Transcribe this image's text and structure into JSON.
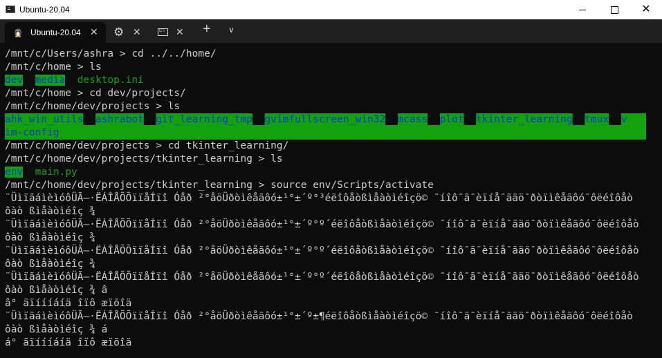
{
  "window": {
    "title": "Ubuntu-20.04",
    "minimize": "—",
    "maximize": "☐",
    "close": "✕"
  },
  "tabs": {
    "active_label": "Ubuntu-20.04",
    "close_glyph": "✕",
    "gear_glyph": "⚙",
    "cmd_glyph": "C:\\",
    "new_tab_glyph": "+",
    "dropdown_glyph": "∨"
  },
  "terminal": {
    "lines": [
      {
        "prompt": "/mnt/c/Users/ashra",
        "cmd": " > cd ../../home/"
      },
      {
        "dirs": [
          "dev",
          "media"
        ],
        "files": [
          "desktop.ini"
        ]
      },
      {
        "prompt": "/mnt/c/home",
        "cmd": " > ls"
      },
      {
        "prompt": "/mnt/c/home",
        "cmd": " > cd dev/projects/"
      },
      {
        "prompt": "/mnt/c/home/dev/projects",
        "cmd": " > ls"
      },
      {
        "row1": [
          "ahk_win_utils",
          "ashrabot",
          "git_learning_tmp",
          "gvimfullscreen_win32",
          "mcass",
          "plot",
          "tkinter_learning",
          "tmux",
          "v"
        ],
        "row2": "im-config"
      },
      {
        "prompt": "/mnt/c/home/dev/projects",
        "cmd": " > cd tkinter_learning/"
      },
      {
        "prompt": "/mnt/c/home/dev/projects/tkinter_learning",
        "cmd": " > ls"
      },
      {
        "dirs": [
          "env"
        ],
        "files": [
          "main.py"
        ]
      },
      {
        "prompt": "/mnt/c/home/dev/projects/tkinter_learning",
        "cmd": " > source env/Scripts/activate"
      }
    ],
    "garbled": {
      "a": "¨ÜìïãáìèìóôÜÃ–·ËÁÎÅÕÕïïåÍïî Óåð ²°åöÜðòìêåãôó±¹°±´º°³éëîôåòßìåàòìéîçö© ¯íîô¯ã¯èïíå¯ãäö¯ðòïìêåãôó¯ôëéîôåò",
      "a2": "¨ÜìïãáìèìóôÜÃ–·ËÁÎÅÕÕïïåÍïî Óåð ²°åöÜðòìêåãôó±¹°±´º°º´éëîôåòßìåàòìéîçö© ¯íîô¯ã¯èïíå¯ãäö¯ðòïìêåãôó¯ôëéîôåò",
      "a3": "¨ÜìïãáìèìóôÜÃ–·ËÁÎÅÕÕïïåÍïî Óåð ²°åöÜðòìêåãôó±¹°±´º°º´éëîôåòßìåàòìéîçö© ¯íîô¯ã¯èïíå¯ãäö¯ðòïìêåãôó¯ôëéîôåò",
      "a4": "¨ÜìïãáìèìóôÜÃ–·ËÁÎÅÕÕïïåÍïî Óåð ²°åöÜðòìêåãôó±¹°±´º°º´éëîôåòßìåàòìéîçö© ¯íîô¯ã¯èïíå¯ãäö¯ðòïìêåãôó¯ôëéîôåò",
      "a5": "¨ÜìïãáìèìóôÜÃ–·ËÁÎÅÕÕïïåÍïî Óåð ²°åöÜðòìêåãôó±¹°±´º±¶éëîôåòßìåàòìéîçö© ¯íîô¯ã¯èïíå¯ãäö¯ðòïìêåãôó¯ôëéîôåò",
      "b": "ôàò ßìåàòìéîç ¾",
      "b4": "ôàò ßìåàòìéîç ¾ â",
      "c4": "â° ãïíííáíä îïô æïõîä",
      "b5": "ôàò ßìåàòìéîç ¾ á",
      "c5": "á° ãïíííáíä îïô æïõîä"
    }
  },
  "colors": {
    "background": "#0c0c0c",
    "text": "#cccccc",
    "dir_bg": "#13a10e",
    "dir_fg": "#0037da"
  }
}
